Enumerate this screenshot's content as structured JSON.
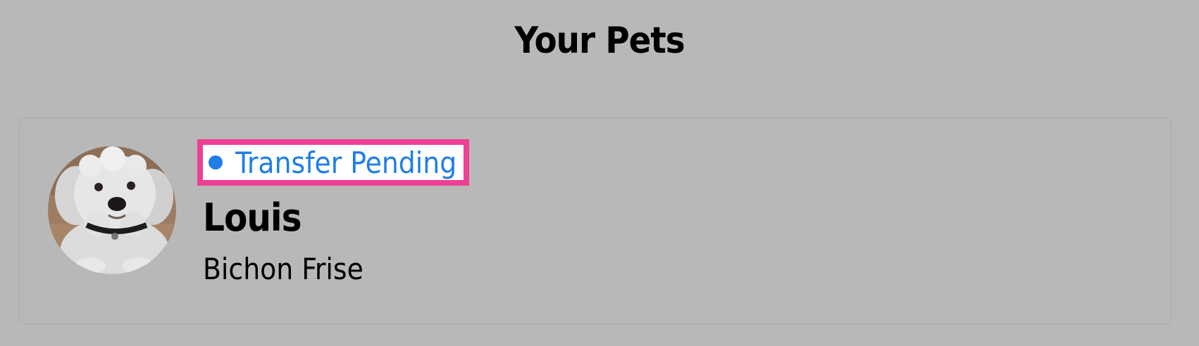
{
  "header": {
    "title": "Your Pets"
  },
  "pets": [
    {
      "status": "Transfer Pending",
      "name": "Louis",
      "breed": "Bichon Frise",
      "avatar_icon": "dog-photo"
    }
  ],
  "colors": {
    "background": "#b8b8b8",
    "status_blue": "#1f7ee8",
    "highlight_pink": "#ee3f94"
  }
}
